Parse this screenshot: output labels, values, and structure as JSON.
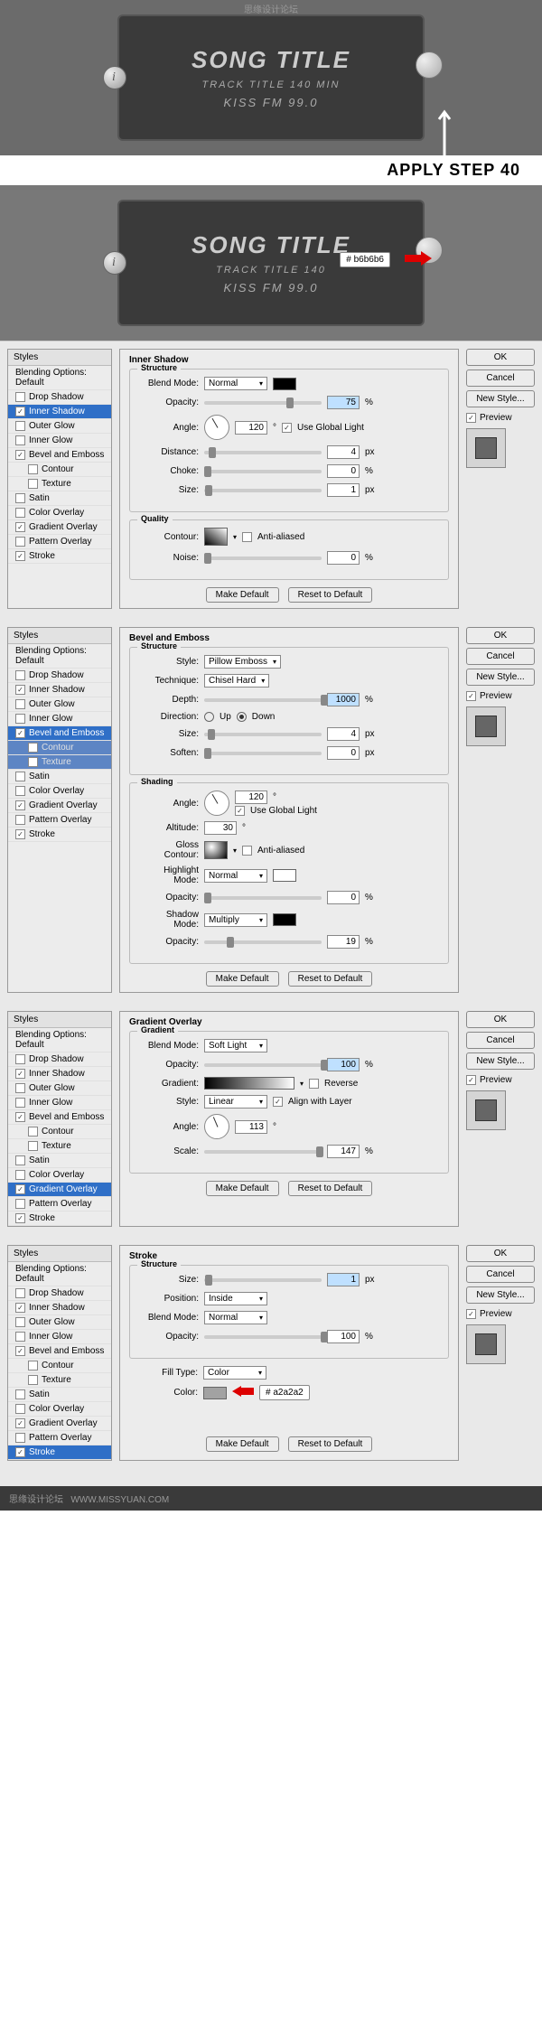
{
  "watermark_top": "思缘设计论坛",
  "watermark_url": "WWW.MISSYUAN.COM",
  "display1": {
    "title": "SONG TITLE",
    "track": "TRACK TITLE   140 MIN",
    "station": "KISS FM 99.0"
  },
  "display2": {
    "title": "SONG TITLE",
    "track": "TRACK TITLE   140",
    "station": "KISS FM 99.0",
    "hex_label": "#",
    "hex": "b6b6b6"
  },
  "apply_label": "APPLY STEP 40",
  "common": {
    "styles_header": "Styles",
    "blending_default": "Blending Options: Default",
    "drop_shadow": "Drop Shadow",
    "inner_shadow": "Inner Shadow",
    "outer_glow": "Outer Glow",
    "inner_glow": "Inner Glow",
    "bevel_emboss": "Bevel and Emboss",
    "contour": "Contour",
    "texture": "Texture",
    "satin": "Satin",
    "color_overlay": "Color Overlay",
    "gradient_overlay": "Gradient Overlay",
    "pattern_overlay": "Pattern Overlay",
    "stroke": "Stroke",
    "ok": "OK",
    "cancel": "Cancel",
    "new_style": "New Style...",
    "preview": "Preview",
    "make_default": "Make Default",
    "reset_default": "Reset to Default"
  },
  "panel1": {
    "title": "Inner Shadow",
    "structure": "Structure",
    "blend_mode_lbl": "Blend Mode:",
    "blend_mode": "Normal",
    "opacity_lbl": "Opacity:",
    "opacity": "75",
    "pct": "%",
    "angle_lbl": "Angle:",
    "angle": "120",
    "deg": "°",
    "global_light": "Use Global Light",
    "distance_lbl": "Distance:",
    "distance": "4",
    "px": "px",
    "choke_lbl": "Choke:",
    "choke": "0",
    "size_lbl": "Size:",
    "size": "1",
    "quality": "Quality",
    "contour_lbl": "Contour:",
    "aa": "Anti-aliased",
    "noise_lbl": "Noise:",
    "noise": "0"
  },
  "panel2": {
    "title": "Bevel and Emboss",
    "structure": "Structure",
    "style_lbl": "Style:",
    "style": "Pillow Emboss",
    "technique_lbl": "Technique:",
    "technique": "Chisel Hard",
    "depth_lbl": "Depth:",
    "depth": "1000",
    "pct": "%",
    "direction_lbl": "Direction:",
    "up": "Up",
    "down": "Down",
    "size_lbl": "Size:",
    "size": "4",
    "px": "px",
    "soften_lbl": "Soften:",
    "soften": "0",
    "shading": "Shading",
    "angle_lbl": "Angle:",
    "angle": "120",
    "deg": "°",
    "global_light": "Use Global Light",
    "altitude_lbl": "Altitude:",
    "altitude": "30",
    "gloss_lbl": "Gloss Contour:",
    "aa": "Anti-aliased",
    "hl_mode_lbl": "Highlight Mode:",
    "hl_mode": "Normal",
    "hl_opacity_lbl": "Opacity:",
    "hl_opacity": "0",
    "sh_mode_lbl": "Shadow Mode:",
    "sh_mode": "Multiply",
    "sh_opacity_lbl": "Opacity:",
    "sh_opacity": "19"
  },
  "panel3": {
    "title": "Gradient Overlay",
    "gradient": "Gradient",
    "blend_mode_lbl": "Blend Mode:",
    "blend_mode": "Soft Light",
    "opacity_lbl": "Opacity:",
    "opacity": "100",
    "pct": "%",
    "gradient_lbl": "Gradient:",
    "reverse": "Reverse",
    "style_lbl": "Style:",
    "style": "Linear",
    "align": "Align with Layer",
    "angle_lbl": "Angle:",
    "angle": "113",
    "deg": "°",
    "scale_lbl": "Scale:",
    "scale": "147"
  },
  "panel4": {
    "title": "Stroke",
    "structure": "Structure",
    "size_lbl": "Size:",
    "size": "1",
    "px": "px",
    "position_lbl": "Position:",
    "position": "Inside",
    "blend_mode_lbl": "Blend Mode:",
    "blend_mode": "Normal",
    "opacity_lbl": "Opacity:",
    "opacity": "100",
    "pct": "%",
    "fill_type_lbl": "Fill Type:",
    "fill_type": "Color",
    "color_lbl": "Color:",
    "hex_label": "#",
    "hex": "a2a2a2"
  },
  "footer": {
    "text": "思缘设计论坛",
    "url": "WWW.MISSYUAN.COM"
  }
}
